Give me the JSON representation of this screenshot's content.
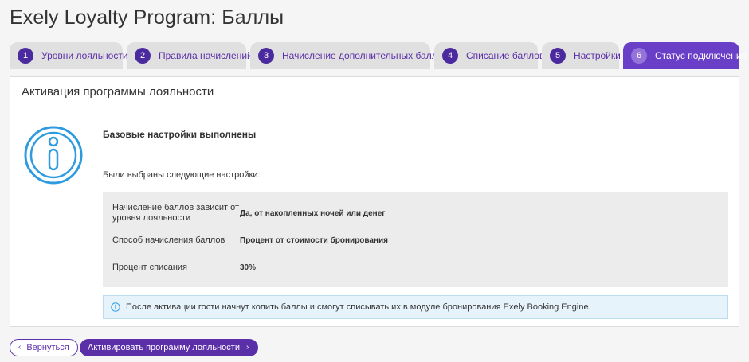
{
  "page": {
    "title": "Exely Loyalty Program: Баллы"
  },
  "steps": [
    {
      "num": "1",
      "label": "Уровни лояльности",
      "active": false
    },
    {
      "num": "2",
      "label": "Правила начислений",
      "active": false
    },
    {
      "num": "3",
      "label": "Начисление дополнительных баллов",
      "active": false
    },
    {
      "num": "4",
      "label": "Списание баллов",
      "active": false
    },
    {
      "num": "5",
      "label": "Настройки",
      "active": false
    },
    {
      "num": "6",
      "label": "Статус подключения",
      "active": true
    }
  ],
  "card": {
    "title": "Активация программы лояльности",
    "icon": "info-circle-icon",
    "content_title": "Базовые настройки выполнены",
    "content_sub": "Были выбраны следующие настройки:",
    "settings": [
      {
        "label": "Начисление баллов зависит от уровня лояльности",
        "value": "Да, от накопленных ночей или денег"
      },
      {
        "label": "Способ начисления баллов",
        "value": "Процент от стоимости бронирования"
      },
      {
        "label": "Процент списания",
        "value": "30%"
      }
    ],
    "notice": "После активации гости начнут копить баллы и смогут списывать их в модуле бронирования Exely Booking Engine."
  },
  "footer": {
    "back_label": "Вернуться",
    "activate_label": "Активировать программу лояльности"
  },
  "colors": {
    "accent": "#5b2fa8",
    "active_step": "#6a3fc8",
    "info_blue": "#2e9be0",
    "notice_bg": "#e6f3fb"
  }
}
